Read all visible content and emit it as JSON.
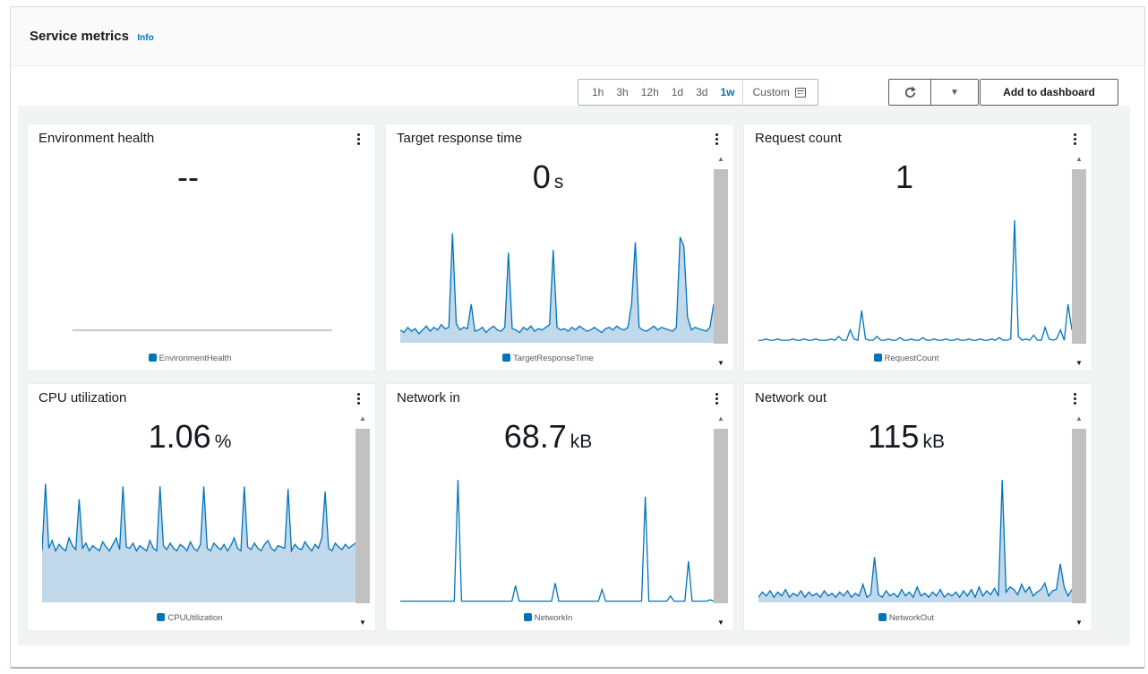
{
  "header": {
    "title": "Service metrics",
    "info": "Info"
  },
  "toolbar": {
    "ranges": [
      "1h",
      "3h",
      "12h",
      "1d",
      "3d",
      "1w"
    ],
    "active_range": "1w",
    "custom_label": "Custom",
    "add_label": "Add to dashboard"
  },
  "icons": {
    "refresh": "refresh-icon",
    "dropdown": "caret-down-icon",
    "calendar": "calendar-icon",
    "kebab": "more-vertical-icon"
  },
  "colors": {
    "series": "#0073bb",
    "fill": "#c1d9ea",
    "link": "#0073bb"
  },
  "cards": [
    {
      "title": "Environment health",
      "value": "--",
      "unit": "",
      "legend": "EnvironmentHealth",
      "chart_data": {
        "type": "line",
        "series": [
          {
            "name": "EnvironmentHealth",
            "values": []
          }
        ]
      }
    },
    {
      "title": "Target response time",
      "value": "0",
      "unit": "s",
      "legend": "TargetResponseTime",
      "chart_data": {
        "type": "area",
        "series": [
          {
            "name": "TargetResponseTime",
            "values": [
              0.1,
              0.08,
              0.12,
              0.09,
              0.11,
              0.07,
              0.1,
              0.13,
              0.09,
              0.12,
              0.1,
              0.14,
              0.11,
              0.12,
              0.85,
              0.15,
              0.1,
              0.12,
              0.11,
              0.3,
              0.09,
              0.1,
              0.12,
              0.08,
              0.11,
              0.13,
              0.1,
              0.09,
              0.12,
              0.7,
              0.11,
              0.1,
              0.08,
              0.12,
              0.1,
              0.13,
              0.09,
              0.11,
              0.1,
              0.12,
              0.14,
              0.72,
              0.12,
              0.1,
              0.11,
              0.09,
              0.12,
              0.1,
              0.13,
              0.11,
              0.09,
              0.1,
              0.12,
              0.1,
              0.08,
              0.11,
              0.12,
              0.1,
              0.13,
              0.11,
              0.1,
              0.12,
              0.3,
              0.78,
              0.12,
              0.1,
              0.09,
              0.11,
              0.13,
              0.1,
              0.12,
              0.11,
              0.1,
              0.09,
              0.12,
              0.82,
              0.75,
              0.2,
              0.1,
              0.12,
              0.11,
              0.1,
              0.09,
              0.12,
              0.3
            ]
          }
        ]
      }
    },
    {
      "title": "Request count",
      "value": "1",
      "unit": "",
      "legend": "RequestCount",
      "chart_data": {
        "type": "line",
        "series": [
          {
            "name": "RequestCount",
            "values": [
              0.02,
              0.02,
              0.03,
              0.02,
              0.02,
              0.03,
              0.02,
              0.02,
              0.02,
              0.03,
              0.02,
              0.02,
              0.03,
              0.02,
              0.02,
              0.03,
              0.02,
              0.02,
              0.02,
              0.03,
              0.02,
              0.05,
              0.02,
              0.02,
              0.1,
              0.03,
              0.02,
              0.25,
              0.03,
              0.02,
              0.02,
              0.05,
              0.02,
              0.02,
              0.03,
              0.02,
              0.02,
              0.04,
              0.02,
              0.02,
              0.03,
              0.02,
              0.02,
              0.04,
              0.02,
              0.02,
              0.03,
              0.02,
              0.02,
              0.03,
              0.02,
              0.02,
              0.03,
              0.02,
              0.02,
              0.03,
              0.02,
              0.02,
              0.03,
              0.02,
              0.02,
              0.03,
              0.02,
              0.04,
              0.02,
              0.02,
              0.03,
              0.95,
              0.05,
              0.02,
              0.03,
              0.02,
              0.06,
              0.02,
              0.02,
              0.12,
              0.03,
              0.02,
              0.03,
              0.1,
              0.02,
              0.3,
              0.1
            ]
          }
        ]
      }
    },
    {
      "title": "CPU utilization",
      "value": "1.06",
      "unit": "%",
      "legend": "CPUUtilization",
      "chart_data": {
        "type": "area",
        "series": [
          {
            "name": "CPUUtilization",
            "values": [
              0.4,
              0.92,
              0.42,
              0.48,
              0.4,
              0.45,
              0.42,
              0.4,
              0.5,
              0.44,
              0.41,
              0.8,
              0.42,
              0.46,
              0.4,
              0.44,
              0.42,
              0.4,
              0.47,
              0.43,
              0.4,
              0.45,
              0.5,
              0.41,
              0.9,
              0.43,
              0.42,
              0.46,
              0.4,
              0.44,
              0.42,
              0.4,
              0.48,
              0.42,
              0.4,
              0.9,
              0.44,
              0.41,
              0.46,
              0.42,
              0.4,
              0.45,
              0.43,
              0.4,
              0.47,
              0.42,
              0.4,
              0.45,
              0.9,
              0.42,
              0.4,
              0.46,
              0.43,
              0.41,
              0.45,
              0.4,
              0.44,
              0.5,
              0.42,
              0.4,
              0.9,
              0.43,
              0.41,
              0.46,
              0.42,
              0.4,
              0.45,
              0.48,
              0.42,
              0.4,
              0.44,
              0.43,
              0.42,
              0.88,
              0.4,
              0.45,
              0.42,
              0.41,
              0.47,
              0.43,
              0.4,
              0.45,
              0.42,
              0.5,
              0.86,
              0.42,
              0.4,
              0.46,
              0.43,
              0.41,
              0.45,
              0.42,
              0.44,
              0.46
            ]
          }
        ]
      }
    },
    {
      "title": "Network in",
      "value": "68.7",
      "unit": "kB",
      "legend": "NetworkIn",
      "chart_data": {
        "type": "line",
        "series": [
          {
            "name": "NetworkIn",
            "values": [
              0.01,
              0.01,
              0.01,
              0.01,
              0.01,
              0.01,
              0.01,
              0.01,
              0.01,
              0.01,
              0.01,
              0.01,
              0.01,
              0.01,
              0.01,
              0.01,
              0.95,
              0.01,
              0.01,
              0.01,
              0.01,
              0.01,
              0.01,
              0.01,
              0.01,
              0.01,
              0.01,
              0.01,
              0.01,
              0.01,
              0.01,
              0.01,
              0.13,
              0.01,
              0.01,
              0.01,
              0.01,
              0.01,
              0.01,
              0.01,
              0.01,
              0.01,
              0.01,
              0.15,
              0.01,
              0.01,
              0.01,
              0.01,
              0.01,
              0.01,
              0.01,
              0.01,
              0.01,
              0.01,
              0.01,
              0.01,
              0.1,
              0.01,
              0.01,
              0.01,
              0.01,
              0.01,
              0.01,
              0.01,
              0.01,
              0.01,
              0.01,
              0.01,
              0.82,
              0.01,
              0.01,
              0.01,
              0.01,
              0.01,
              0.01,
              0.05,
              0.01,
              0.01,
              0.01,
              0.01,
              0.32,
              0.01,
              0.01,
              0.01,
              0.01,
              0.01,
              0.02,
              0.01
            ]
          }
        ]
      }
    },
    {
      "title": "Network out",
      "value": "115",
      "unit": "kB",
      "legend": "NetworkOut",
      "chart_data": {
        "type": "area",
        "series": [
          {
            "name": "NetworkOut",
            "values": [
              0.04,
              0.08,
              0.05,
              0.09,
              0.04,
              0.08,
              0.05,
              0.1,
              0.04,
              0.07,
              0.05,
              0.09,
              0.04,
              0.08,
              0.05,
              0.07,
              0.04,
              0.09,
              0.05,
              0.07,
              0.04,
              0.08,
              0.05,
              0.09,
              0.04,
              0.07,
              0.05,
              0.14,
              0.04,
              0.06,
              0.35,
              0.06,
              0.04,
              0.09,
              0.05,
              0.07,
              0.04,
              0.1,
              0.05,
              0.08,
              0.04,
              0.12,
              0.05,
              0.07,
              0.04,
              0.08,
              0.05,
              0.1,
              0.04,
              0.07,
              0.05,
              0.08,
              0.04,
              0.09,
              0.05,
              0.1,
              0.04,
              0.12,
              0.05,
              0.09,
              0.06,
              0.11,
              0.05,
              0.95,
              0.08,
              0.12,
              0.1,
              0.06,
              0.14,
              0.08,
              0.12,
              0.05,
              0.08,
              0.1,
              0.15,
              0.05,
              0.09,
              0.1,
              0.3,
              0.12,
              0.05,
              0.1
            ]
          }
        ]
      }
    }
  ]
}
